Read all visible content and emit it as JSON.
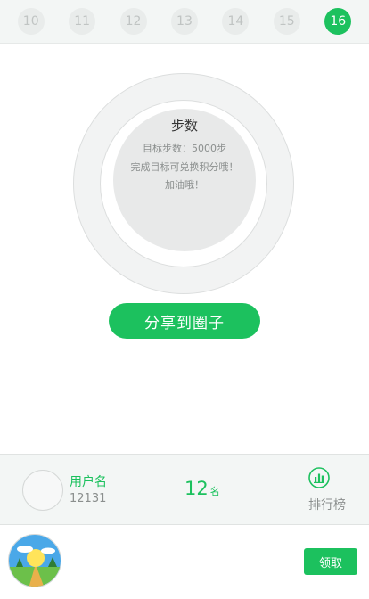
{
  "dates": {
    "items": [
      "10",
      "11",
      "12",
      "13",
      "14",
      "15",
      "16"
    ],
    "active_index": 6
  },
  "steps": {
    "title": "步数",
    "goal": "目标步数：5000步",
    "hint1": "完成目标可兑换积分哦！",
    "hint2": "加油哦！"
  },
  "share": {
    "label": "分享到圈子"
  },
  "user": {
    "name": "用户名",
    "id": "12131",
    "rank": "12",
    "rank_unit": "名",
    "rank_label": "排行榜"
  },
  "reward": {
    "claim_label": "领取"
  },
  "colors": {
    "accent": "#1cc15e",
    "muted": "#8b8f8e",
    "strip_bg": "#f3f6f5"
  },
  "icons": {
    "leaderboard": "bar-chart-icon"
  }
}
